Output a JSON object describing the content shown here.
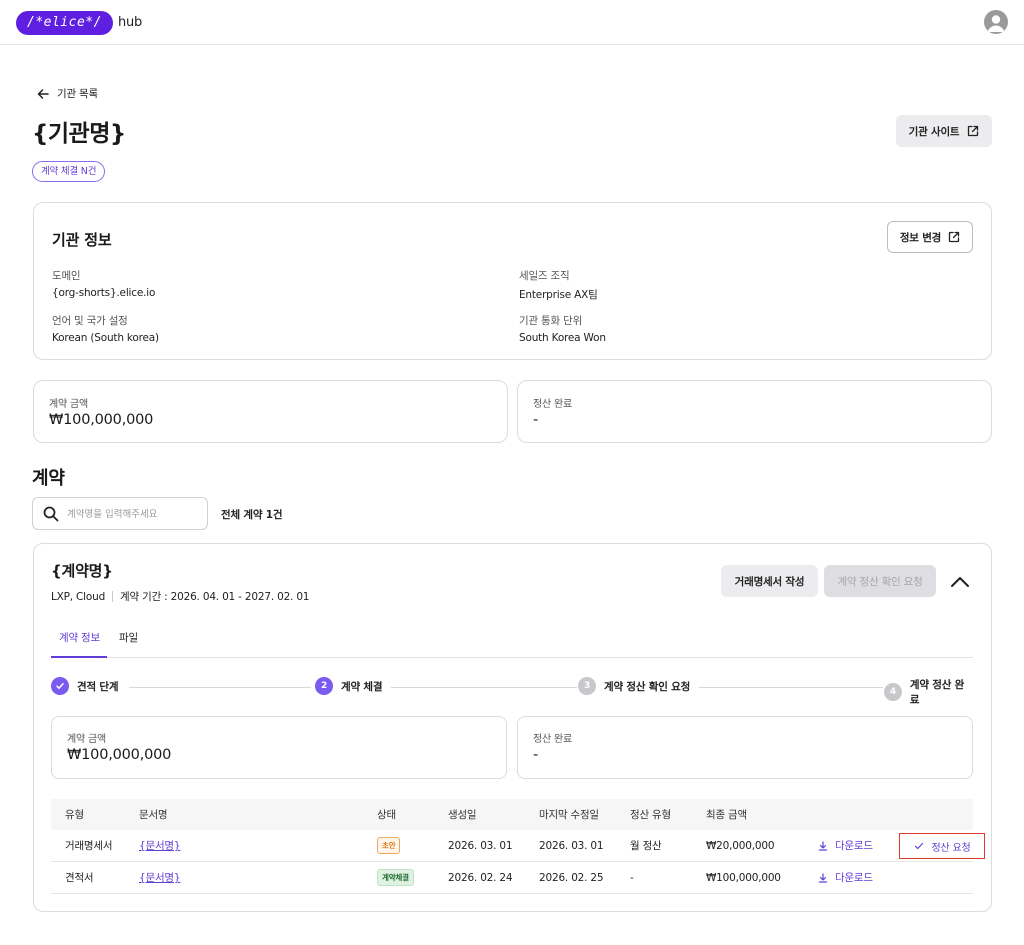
{
  "header": {
    "logo_text": "/*elice*/",
    "logo_suffix": "hub",
    "accent_color": "#5f1fe0"
  },
  "page": {
    "back_label": "기관 목록",
    "title": "{기관명}",
    "site_button_label": "기관 사이트",
    "contract_chip": "계약 체결 N건"
  },
  "org_info": {
    "title": "기관 정보",
    "edit_button_label": "정보 변경",
    "fields": [
      {
        "label": "도메인",
        "value": "{org-shorts}.elice.io"
      },
      {
        "label": "세일즈 조직",
        "value": "Enterprise AX팀"
      },
      {
        "label": "언어 및 국가 설정",
        "value": "Korean (South korea)"
      },
      {
        "label": "기관 통화 단위",
        "value": "South Korea Won"
      }
    ]
  },
  "summary": {
    "contract_amount_label": "계약 금액",
    "contract_amount_value": "₩100,000,000",
    "settlement_label": "정산 완료",
    "settlement_value": "-"
  },
  "contracts_section": {
    "title": "계약",
    "search_placeholder": "계약명을 입력해주세요",
    "total_label": "전체 계약 1건"
  },
  "contract": {
    "name": "{계약명}",
    "products": "LXP, Cloud",
    "period": "계약 기간 : 2026. 04. 01 - 2027. 02. 01",
    "invoice_button": "거래명세서 작성",
    "request_button": "계약 정산 확인 요청",
    "tabs": [
      {
        "label": "계약 정보",
        "active": true
      },
      {
        "label": "파일",
        "active": false
      }
    ],
    "steps": [
      {
        "number": "✓",
        "label": "견적 단계",
        "state": "done"
      },
      {
        "number": "2",
        "label": "계약 체결",
        "state": "current"
      },
      {
        "number": "3",
        "label": "계약 정산 확인 요청",
        "state": "todo"
      },
      {
        "number": "4",
        "label": "계약 정산 완료",
        "state": "todo"
      }
    ],
    "amount_label": "계약 금액",
    "amount_value": "₩100,000,000",
    "settlement_label": "정산 완료",
    "settlement_value": "-",
    "table": {
      "columns": [
        "유형",
        "문서명",
        "상태",
        "생성일",
        "마지막 수정일",
        "정산 유형",
        "최종 금액"
      ],
      "rows": [
        {
          "type": "거래명세서",
          "doc": "{문서명}",
          "status": "초안",
          "created": "2026. 03. 01",
          "modified": "2026. 03. 01",
          "settle_type": "월 정산",
          "amount": "₩20,000,000",
          "download": "다운로드",
          "action": "정산 요청"
        },
        {
          "type": "견적서",
          "doc": "{문서명}",
          "status": "계약체결",
          "created": "2026. 02. 24",
          "modified": "2026. 02. 25",
          "settle_type": "-",
          "amount": "₩100,000,000",
          "download": "다운로드"
        }
      ]
    }
  }
}
